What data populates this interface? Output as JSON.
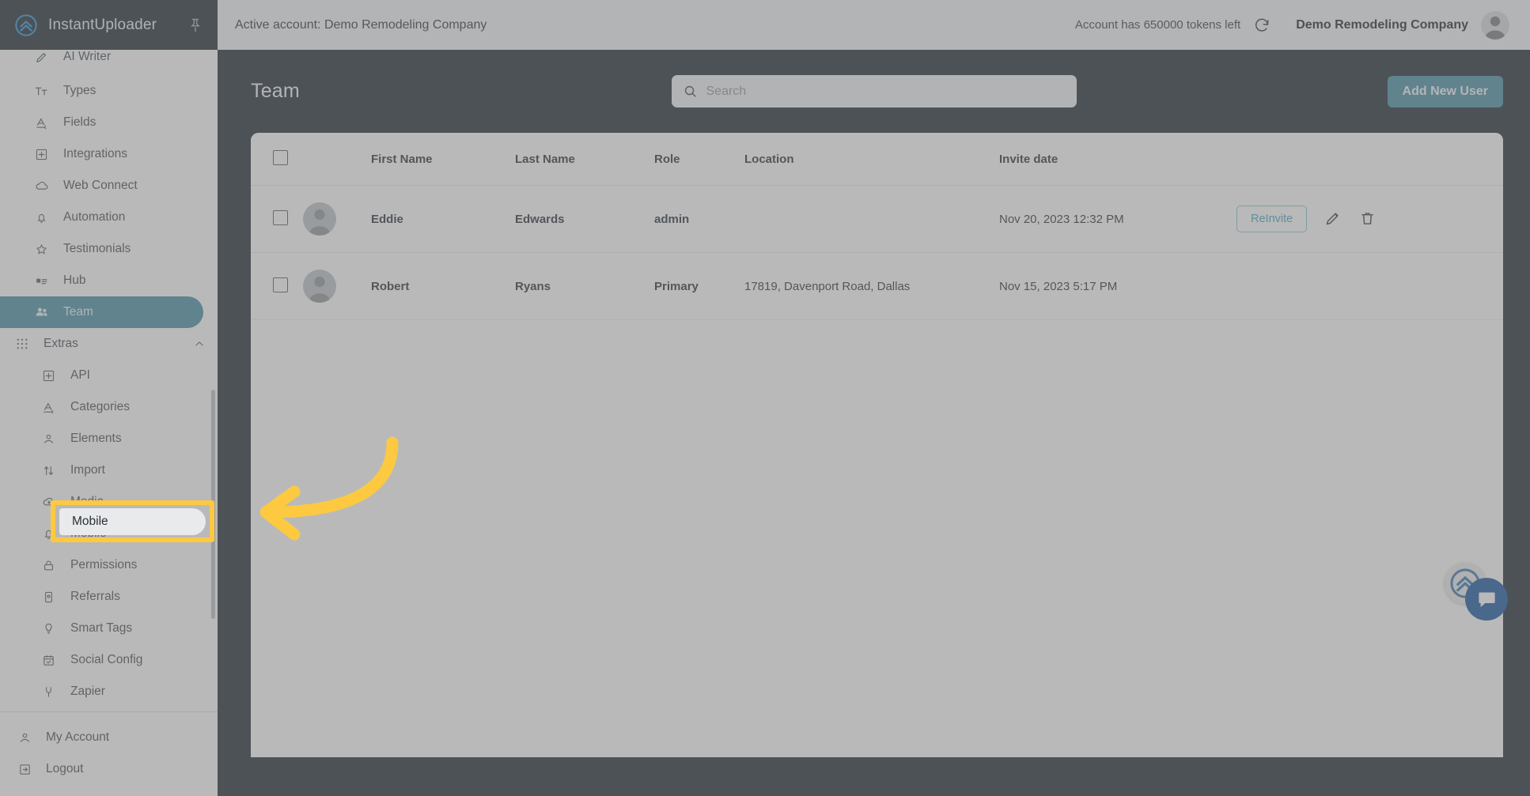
{
  "brand": {
    "name": "InstantUploader",
    "logo_icon": "double-chevron-circle-icon",
    "pin_icon": "pin-icon"
  },
  "sidebar": {
    "items": [
      {
        "label": "AI Writer",
        "icon": "pencil-icon",
        "state": "clipped"
      },
      {
        "label": "Types",
        "icon": "text-size-icon",
        "state": "normal"
      },
      {
        "label": "Fields",
        "icon": "letter-a-icon",
        "state": "normal"
      },
      {
        "label": "Integrations",
        "icon": "plus-square-icon",
        "state": "normal"
      },
      {
        "label": "Web Connect",
        "icon": "cloud-icon",
        "state": "normal"
      },
      {
        "label": "Automation",
        "icon": "bell-icon",
        "state": "normal"
      },
      {
        "label": "Testimonials",
        "icon": "star-icon",
        "state": "normal"
      },
      {
        "label": "Hub",
        "icon": "card-list-icon",
        "state": "normal"
      },
      {
        "label": "Team",
        "icon": "people-icon",
        "state": "active"
      }
    ],
    "group": {
      "label": "Extras",
      "icon": "grid-dots-icon",
      "chevron": "chevron-up-icon",
      "items": [
        {
          "label": "API",
          "icon": "plus-square-icon"
        },
        {
          "label": "Categories",
          "icon": "letter-a-icon"
        },
        {
          "label": "Elements",
          "icon": "person-icon"
        },
        {
          "label": "Import",
          "icon": "up-down-arrows-icon"
        },
        {
          "label": "Media",
          "icon": "cloud-download-icon"
        },
        {
          "label": "Mobile",
          "icon": "bell-icon"
        },
        {
          "label": "Permissions",
          "icon": "lock-icon"
        },
        {
          "label": "Referrals",
          "icon": "phone-icon"
        },
        {
          "label": "Smart Tags",
          "icon": "lightbulb-icon"
        },
        {
          "label": "Social Config",
          "icon": "calendar-check-icon"
        },
        {
          "label": "Zapier",
          "icon": "plug-icon"
        }
      ]
    },
    "bottom": [
      {
        "label": "My Account",
        "icon": "person-icon"
      },
      {
        "label": "Logout",
        "icon": "logout-icon"
      }
    ]
  },
  "topbar": {
    "active_account": "Active account: Demo Remodeling Company",
    "tokens": "Account has 650000 tokens left",
    "refresh_icon": "refresh-icon",
    "account_name": "Demo Remodeling Company",
    "avatar_icon": "avatar-icon"
  },
  "page": {
    "title": "Team",
    "search": {
      "placeholder": "Search",
      "value": "",
      "icon": "search-icon"
    },
    "add_user_label": "Add New User"
  },
  "table": {
    "columns": [
      "",
      "",
      "First Name",
      "Last Name",
      "Role",
      "Location",
      "Invite date",
      ""
    ],
    "rows": [
      {
        "first_name": "Eddie",
        "last_name": "Edwards",
        "role": "admin",
        "location": "",
        "invite_date": "Nov 20, 2023 12:32 PM",
        "reinvite_label": "ReInvite",
        "has_reinvite": true
      },
      {
        "first_name": "Robert",
        "last_name": "Ryans",
        "role": "Primary",
        "location": "17819, Davenport Road, Dallas",
        "invite_date": "Nov 15, 2023 5:17 PM",
        "reinvite_label": "",
        "has_reinvite": false
      }
    ]
  },
  "annotation": {
    "highlight_label": "Mobile",
    "arrow_icon": "curved-left-arrow-icon",
    "highlight_color": "#FCC941"
  },
  "widgets": {
    "chat_icon": "chat-bubble-icon",
    "scroll_top_icon": "double-chevron-circle-icon"
  },
  "colors": {
    "accent": "#3b87a0",
    "dark_bg": "#101b26",
    "brand_bar": "#101c27",
    "annotation_yellow": "#FCC941",
    "chat_blue": "#0b4a9c",
    "logo_blue": "#1769b0"
  }
}
